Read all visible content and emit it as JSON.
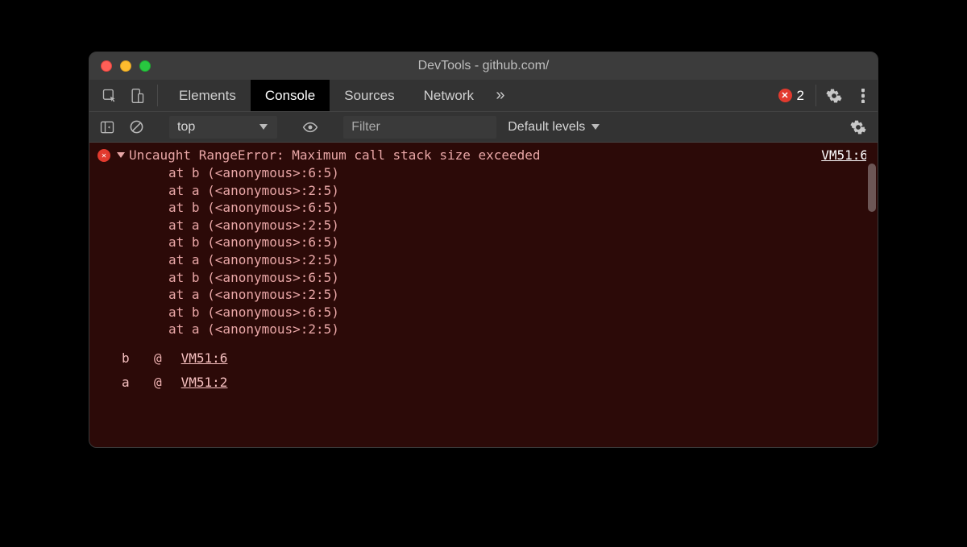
{
  "window": {
    "title": "DevTools - github.com/"
  },
  "maintabs": {
    "elements": "Elements",
    "console": "Console",
    "sources": "Sources",
    "network": "Network",
    "overflow": "»",
    "error_count": "2"
  },
  "ctoolbar": {
    "context": "top",
    "filter_placeholder": "Filter",
    "levels": "Default levels"
  },
  "error": {
    "message": "Uncaught RangeError: Maximum call stack size exceeded",
    "source_link": "VM51:6",
    "stack": [
      "at b (<anonymous>:6:5)",
      "at a (<anonymous>:2:5)",
      "at b (<anonymous>:6:5)",
      "at a (<anonymous>:2:5)",
      "at b (<anonymous>:6:5)",
      "at a (<anonymous>:2:5)",
      "at b (<anonymous>:6:5)",
      "at a (<anonymous>:2:5)",
      "at b (<anonymous>:6:5)",
      "at a (<anonymous>:2:5)"
    ],
    "short": [
      {
        "fn": "b",
        "at": "@",
        "link": "VM51:6"
      },
      {
        "fn": "a",
        "at": "@",
        "link": "VM51:2"
      }
    ]
  }
}
